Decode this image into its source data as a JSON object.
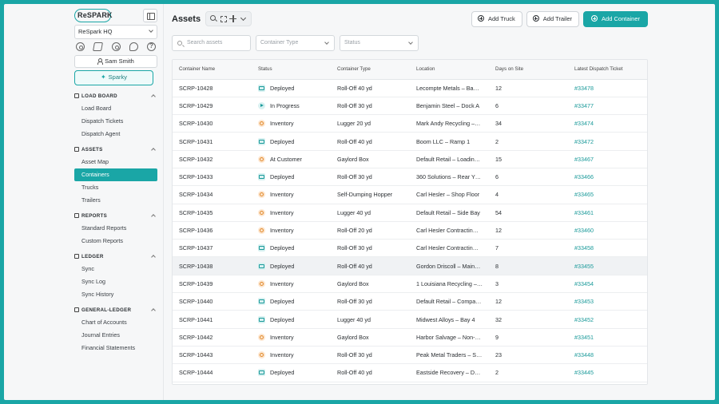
{
  "brand": {
    "logo_text": "ReSPARK"
  },
  "org_select": {
    "value": "ReSpark HQ"
  },
  "user": {
    "name": "Sam Smith"
  },
  "sparky": {
    "label": "Sparky"
  },
  "nav": {
    "sections": [
      {
        "id": "load-board",
        "title": "LOAD BOARD",
        "items": [
          {
            "label": "Load Board"
          },
          {
            "label": "Dispatch Tickets"
          },
          {
            "label": "Dispatch Agent"
          }
        ]
      },
      {
        "id": "assets",
        "title": "ASSETS",
        "items": [
          {
            "label": "Asset Map"
          },
          {
            "label": "Containers"
          },
          {
            "label": "Trucks"
          },
          {
            "label": "Trailers"
          }
        ]
      },
      {
        "id": "reports",
        "title": "REPORTS",
        "items": [
          {
            "label": "Standard Reports"
          },
          {
            "label": "Custom Reports"
          }
        ]
      },
      {
        "id": "ledger",
        "title": "LEDGER",
        "items": [
          {
            "label": "Sync"
          },
          {
            "label": "Sync Log"
          },
          {
            "label": "Sync History"
          }
        ]
      },
      {
        "id": "general-ledger",
        "title": "GENERAL-LEDGER",
        "items": [
          {
            "label": "Chart of Accounts"
          },
          {
            "label": "Journal Entries"
          },
          {
            "label": "Financial Statements"
          }
        ]
      }
    ],
    "active": "Containers"
  },
  "page": {
    "title": "Assets"
  },
  "actions": {
    "add_truck": "Add Truck",
    "add_trailer": "Add Trailer",
    "add_container": "Add Container"
  },
  "filters": {
    "search_placeholder": "Search assets",
    "container_type_placeholder": "Container Type",
    "status_placeholder": "Status"
  },
  "table": {
    "columns": [
      "Container Name",
      "Status",
      "Container Type",
      "Location",
      "Days on Site",
      "Latest Dispatch Ticket"
    ],
    "rows": [
      {
        "name": "SCRP-10428",
        "status": "Deployed",
        "status_icon": "truck-icon",
        "type": "Roll-Off 40 yd",
        "location": "Lecompte Metals – Ba…",
        "days": "12",
        "ticket": "#33478"
      },
      {
        "name": "SCRP-10429",
        "status": "In Progress",
        "status_icon": "play-icon",
        "type": "Roll-Off 30 yd",
        "location": "Benjamin Steel – Dock A",
        "days": "6",
        "ticket": "#33477"
      },
      {
        "name": "SCRP-10430",
        "status": "Inventory",
        "status_icon": "box-icon",
        "type": "Lugger 20 yd",
        "location": "Mark Andy Recycling –…",
        "days": "34",
        "ticket": "#33474"
      },
      {
        "name": "SCRP-10431",
        "status": "Deployed",
        "status_icon": "truck-icon",
        "type": "Roll-Off 40 yd",
        "location": "Boom LLC – Ramp 1",
        "days": "2",
        "ticket": "#33472"
      },
      {
        "name": "SCRP-10432",
        "status": "At Customer",
        "status_icon": "box-icon",
        "type": "Gaylord Box",
        "location": "Default Retail – Loadin…",
        "days": "15",
        "ticket": "#33467"
      },
      {
        "name": "SCRP-10433",
        "status": "Deployed",
        "status_icon": "truck-icon",
        "type": "Roll-Off 30 yd",
        "location": "360 Solutions – Rear Y…",
        "days": "6",
        "ticket": "#33466"
      },
      {
        "name": "SCRP-10434",
        "status": "Inventory",
        "status_icon": "box-icon",
        "type": "Self-Dumping Hopper",
        "location": "Carl Hesler – Shop Floor",
        "days": "4",
        "ticket": "#33465"
      },
      {
        "name": "SCRP-10435",
        "status": "Inventory",
        "status_icon": "box-icon",
        "type": "Lugger 40 yd",
        "location": "Default Retail – Side Bay",
        "days": "54",
        "ticket": "#33461"
      },
      {
        "name": "SCRP-10436",
        "status": "Inventory",
        "status_icon": "box-icon",
        "type": "Roll-Off 20 yd",
        "location": "Carl Hesler Contractin…",
        "days": "12",
        "ticket": "#33460"
      },
      {
        "name": "SCRP-10437",
        "status": "Deployed",
        "status_icon": "truck-icon",
        "type": "Roll-Off 30 yd",
        "location": "Carl Hesler Contractin…",
        "days": "7",
        "ticket": "#33458"
      },
      {
        "name": "SCRP-10438",
        "status": "Deployed",
        "status_icon": "truck-icon",
        "type": "Roll-Off 40 yd",
        "location": "Gordon Driscoll – Main…",
        "days": "8",
        "ticket": "#33455"
      },
      {
        "name": "SCRP-10439",
        "status": "Inventory",
        "status_icon": "box-icon",
        "type": "Gaylord Box",
        "location": "1 Louisiana Recycling –…",
        "days": "3",
        "ticket": "#33454"
      },
      {
        "name": "SCRP-10440",
        "status": "Deployed",
        "status_icon": "truck-icon",
        "type": "Roll-Off 30 yd",
        "location": "Default Retail – Compa…",
        "days": "12",
        "ticket": "#33453"
      },
      {
        "name": "SCRP-10441",
        "status": "Deployed",
        "status_icon": "truck-icon",
        "type": "Lugger 40 yd",
        "location": "Midwest Alloys – Bay 4",
        "days": "32",
        "ticket": "#33452"
      },
      {
        "name": "SCRP-10442",
        "status": "Inventory",
        "status_icon": "box-icon",
        "type": "Gaylord Box",
        "location": "Harbor Salvage – Non-…",
        "days": "9",
        "ticket": "#33451"
      },
      {
        "name": "SCRP-10443",
        "status": "Inventory",
        "status_icon": "box-icon",
        "type": "Roll-Off 30 yd",
        "location": "Peak Metal Traders – S…",
        "days": "23",
        "ticket": "#33448"
      },
      {
        "name": "SCRP-10444",
        "status": "Deployed",
        "status_icon": "truck-icon",
        "type": "Roll-Off 40 yd",
        "location": "Eastside Recovery – D…",
        "days": "2",
        "ticket": "#33445"
      }
    ],
    "highlighted_row": "SCRP-10438"
  },
  "colors": {
    "accent": "#1aa6a6",
    "ticket_link": "#1a9a9a",
    "inventory_icon": "#e08a2c"
  }
}
